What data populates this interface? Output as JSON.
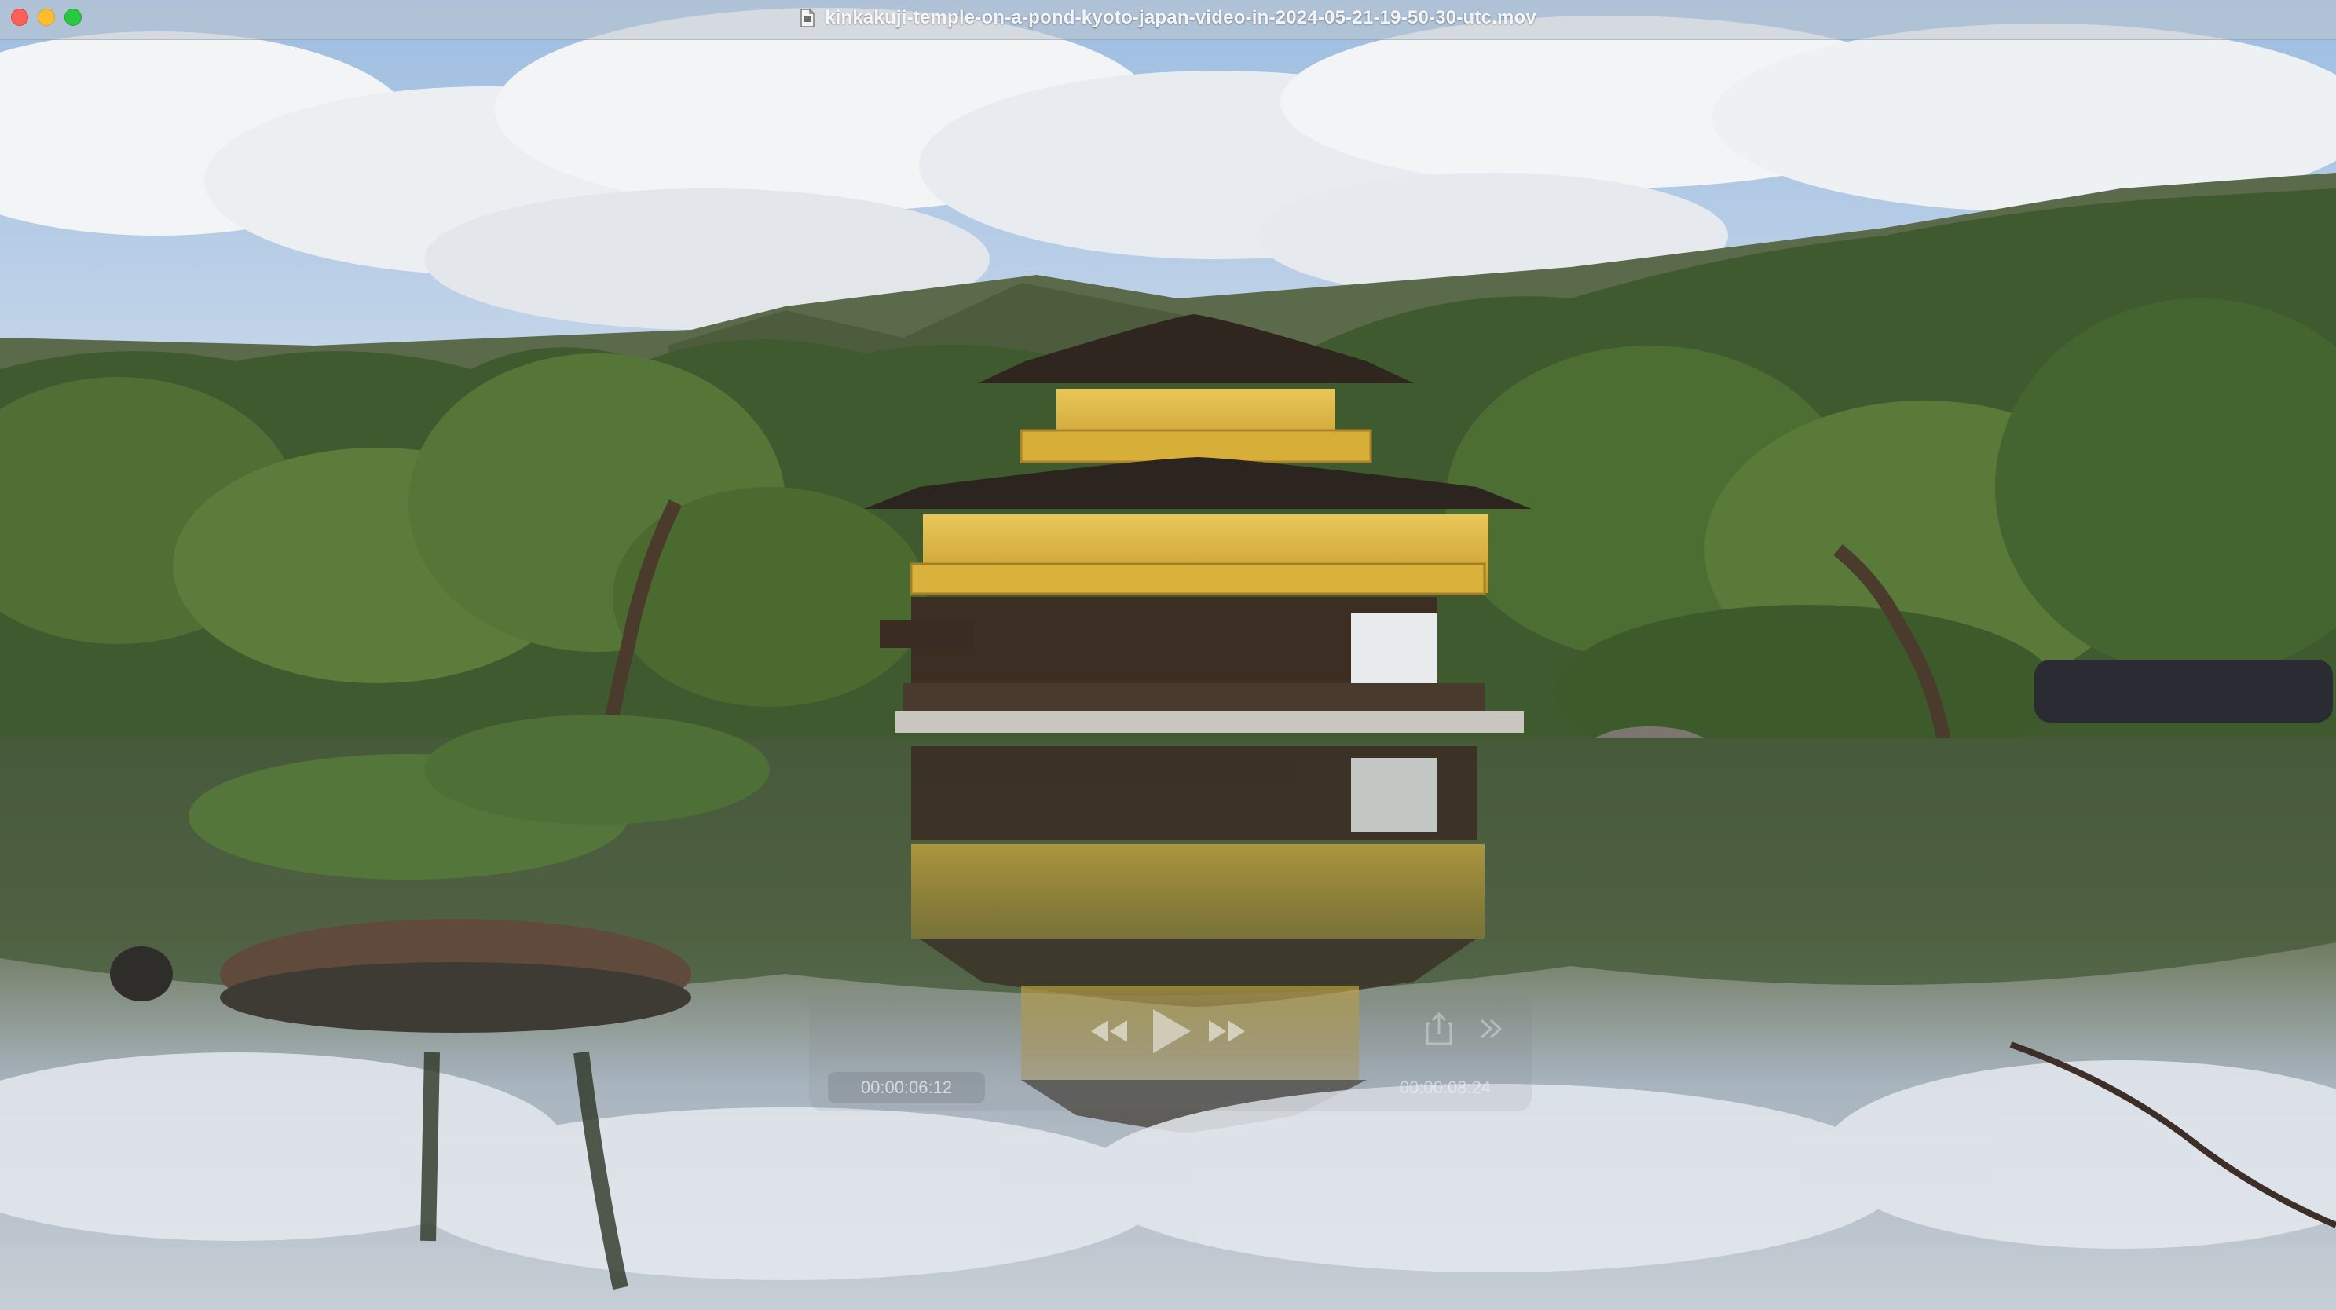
{
  "window": {
    "title": "kinkakuji-temple-on-a-pond-kyoto-japan-video-in-2024-05-21-19-50-30-utc.mov",
    "file_icon": "document-icon",
    "traffic_lights": {
      "close_color": "#fe5f57",
      "minimize_color": "#febc2e",
      "zoom_color": "#28c840"
    }
  },
  "player": {
    "elapsed_time": "00:00:06:12",
    "total_time": "00:00:08:24",
    "controls": {
      "rewind_icon": "rewind-icon",
      "play_icon": "play-icon",
      "fastforward_icon": "fast-forward-icon",
      "share_icon": "share-icon",
      "more_icon": "chevron-right-icon"
    }
  },
  "colors": {
    "temple_gold": "#d8b23c",
    "roof_dark": "#3a2f28",
    "sky": "#8fb4dc",
    "pond": "#5a6a55"
  }
}
